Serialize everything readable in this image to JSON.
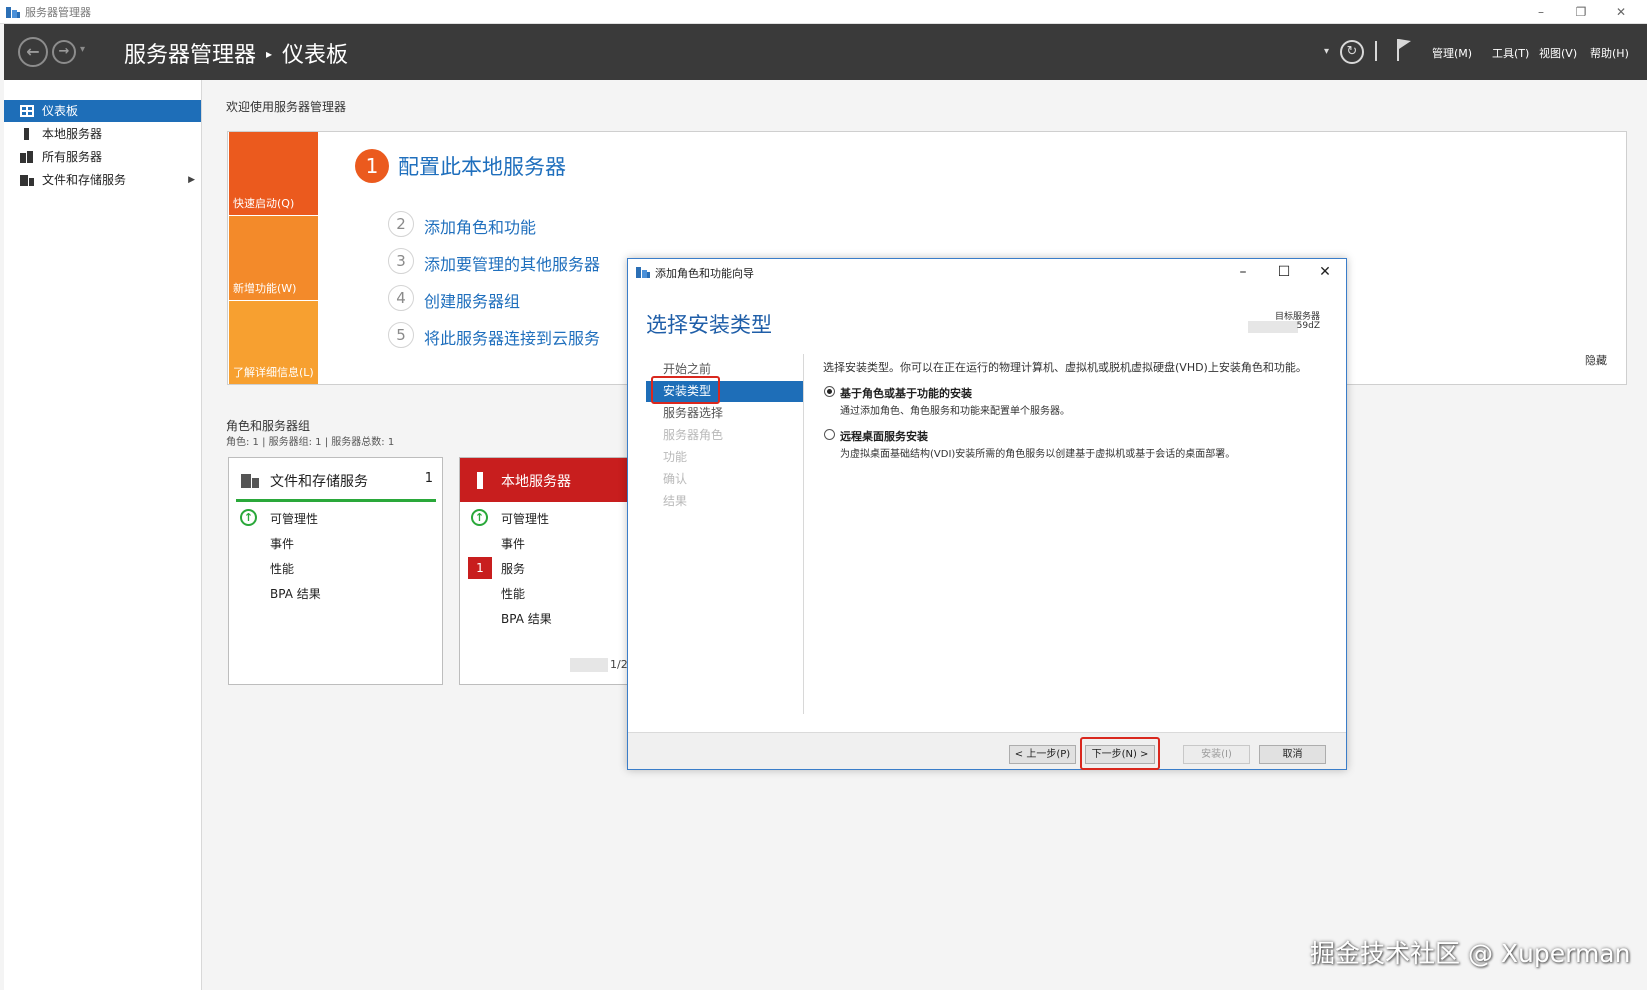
{
  "os_window": {
    "title": "服务器管理器",
    "minimize": "–",
    "restore": "❐",
    "close": "✕"
  },
  "header": {
    "back": "←",
    "forward": "→",
    "dropdown": "▾",
    "breadcrumb_root": "服务器管理器",
    "breadcrumb_sep": "▸",
    "breadcrumb_page": "仪表板",
    "refresh": "↻",
    "menus": [
      "管理(M)",
      "工具(T)",
      "视图(V)",
      "帮助(H)"
    ]
  },
  "sidebar": {
    "items": [
      {
        "label": "仪表板",
        "icon": "dashboard-icon",
        "active": true
      },
      {
        "label": "本地服务器",
        "icon": "local-server-icon",
        "active": false
      },
      {
        "label": "所有服务器",
        "icon": "all-servers-icon",
        "active": false
      },
      {
        "label": "文件和存储服务",
        "icon": "file-storage-icon",
        "active": false,
        "expand": "▶"
      }
    ]
  },
  "main": {
    "welcome": "欢迎使用服务器管理器",
    "tiles": [
      "快速启动(Q)",
      "新增功能(W)",
      "了解详细信息(L)"
    ],
    "step1": {
      "num": "1",
      "label": "配置此本地服务器"
    },
    "steps": [
      {
        "num": "2",
        "label": "添加角色和功能"
      },
      {
        "num": "3",
        "label": "添加要管理的其他服务器"
      },
      {
        "num": "4",
        "label": "创建服务器组"
      },
      {
        "num": "5",
        "label": "将此服务器连接到云服务"
      }
    ],
    "hide": "隐藏",
    "roles_title": "角色和服务器组",
    "roles_sub": "角色: 1 | 服务器组: 1 | 服务器总数: 1"
  },
  "cards": [
    {
      "title": "文件和存储服务",
      "count": "1",
      "rows": [
        "可管理性",
        "事件",
        "性能",
        "BPA 结果"
      ],
      "status_color": "#2aa83a"
    },
    {
      "title": "本地服务器",
      "count": "1",
      "rows": [
        "可管理性",
        "事件",
        "服务",
        "性能",
        "BPA 结果"
      ],
      "service_badge": "1",
      "footer": "1/2",
      "status_color": "#c81e1e"
    }
  ],
  "dialog": {
    "title": "添加角色和功能向导",
    "minimize": "–",
    "maximize": "☐",
    "close": "✕",
    "heading": "选择安装类型",
    "target_label": "目标服务器",
    "target_value": "59dZ",
    "steps": [
      {
        "label": "开始之前",
        "state": "normal"
      },
      {
        "label": "安装类型",
        "state": "active"
      },
      {
        "label": "服务器选择",
        "state": "normal"
      },
      {
        "label": "服务器角色",
        "state": "disabled"
      },
      {
        "label": "功能",
        "state": "disabled"
      },
      {
        "label": "确认",
        "state": "disabled"
      },
      {
        "label": "结果",
        "state": "disabled"
      }
    ],
    "description": "选择安装类型。你可以在正在运行的物理计算机、虚拟机或脱机虚拟硬盘(VHD)上安装角色和功能。",
    "options": [
      {
        "label": "基于角色或基于功能的安装",
        "desc": "通过添加角色、角色服务和功能来配置单个服务器。",
        "selected": true
      },
      {
        "label": "远程桌面服务安装",
        "desc": "为虚拟桌面基础结构(VDI)安装所需的角色服务以创建基于虚拟机或基于会话的桌面部署。",
        "selected": false
      }
    ],
    "buttons": {
      "prev": "< 上一步(P)",
      "next": "下一步(N) >",
      "install": "安装(I)",
      "cancel": "取消"
    }
  },
  "watermark": "掘金技术社区 @ Xuperman",
  "colors": {
    "accent_blue": "#1e6eb8",
    "header_dark": "#3a3a3a",
    "orange": "#eb5a1e",
    "highlight_red": "#d9281e"
  }
}
